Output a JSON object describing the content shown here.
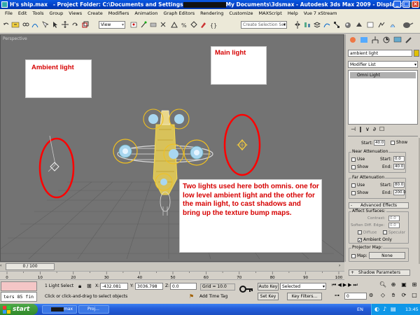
{
  "window": {
    "title_prefix": "H's ship.max",
    "title_folder": "- Project Folder: C:\\Documents and Settings",
    "title_mid": "My Documents\\3dsmax",
    "title_suffix": "- Autodesk 3ds Max  2009",
    "title_display": "- Display :"
  },
  "menu": [
    "File",
    "Edit",
    "Tools",
    "Group",
    "Views",
    "Create",
    "Modifiers",
    "Animation",
    "Graph Editors",
    "Rendering",
    "Customize",
    "MAXScript",
    "Help",
    "Vue 7 xStream"
  ],
  "toolbar": {
    "ref_coord": "View",
    "selection_set_placeholder": "Create Selection Set"
  },
  "viewport": {
    "label": "Perspective",
    "notes": {
      "ambient": "Ambient light",
      "main": "Main light",
      "explain": "Two lights used here both omnis. one for low level ambient light and the other for the main light, to cast shadows and bring up the texture bump maps."
    }
  },
  "panel": {
    "object_name": "ambient light",
    "modifier_list": "Modifier List",
    "stack_item": "Omni Light",
    "start_label": "Start:",
    "start_value": "40.0",
    "show_label": "Show",
    "near_title": "Near Attenuation",
    "near": {
      "use": "Use",
      "show": "Show",
      "start_label": "Start:",
      "start": "0.0",
      "end_label": "End:",
      "end": "40.0"
    },
    "far_title": "Far Attenuation",
    "far": {
      "use": "Use",
      "show": "Show",
      "start_label": "Start:",
      "start": "80.0",
      "end_label": "End:",
      "end": "200.0"
    },
    "advanced_effects": "Advanced Effects",
    "affect_surfaces": "Affect Surfaces:",
    "contrast_label": "Contrast:",
    "contrast": "0.0",
    "soften_label": "Soften Diff. Edge:",
    "soften": "0.0",
    "diffuse": "Diffuse",
    "specular": "Specular",
    "ambient_only": "Ambient Only",
    "projector_map": "Projector Map:",
    "map_label": "Map:",
    "map_value": "None",
    "shadow_params": "Shadow Parameters"
  },
  "timeline": {
    "frame": "0 / 100"
  },
  "ruler_ticks": [
    "0",
    "10",
    "20",
    "30",
    "40",
    "50",
    "60",
    "70",
    "80",
    "90",
    "100"
  ],
  "status": {
    "listener": "ters 85 fin",
    "selected": "1 Light Select",
    "x_label": "X:",
    "x": "-432.081",
    "y_label": "Y:",
    "y": "3036.798",
    "z_label": "Z:",
    "z": "0.0",
    "grid": "Grid = 10.0",
    "prompt": "Click or click-and-drag to select objects",
    "add_time_tag": "Add Time Tag",
    "auto_key": "Auto Key",
    "set_key": "Set Key",
    "selected_dropdown": "Selected",
    "key_filters": "Key Filters...",
    "frame_field": "0"
  },
  "taskbar": {
    "start": "start",
    "task1": "max",
    "task2": "Proj...",
    "lang": "EN",
    "clock": "13:45"
  },
  "colors": {
    "note_text": "#d60000",
    "ellipse": "#ff0000",
    "gizmo": "#ffd23a"
  }
}
